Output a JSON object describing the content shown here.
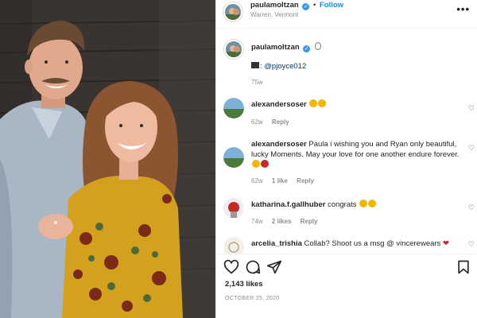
{
  "post": {
    "username": "paulamoltzan",
    "location": "Warren, Vermont",
    "follow_label": "Follow",
    "separator": "•",
    "more_label": "•••"
  },
  "caption": {
    "username": "paulamoltzan",
    "text": ": @pjoyce012",
    "time": "75w"
  },
  "comments": [
    {
      "username": "alexandersoser",
      "text": "",
      "time": "62w",
      "likes": "",
      "reply": "Reply"
    },
    {
      "username": "alexandersoser",
      "text": "Paula i wishing you and Ryan only beautiful, lucky Moments. May your love for one another endure forever.",
      "time": "62w",
      "likes": "1 like",
      "reply": "Reply"
    },
    {
      "username": "katharina.f.gallhuber",
      "text": "congrats",
      "time": "74w",
      "likes": "2 likes",
      "reply": "Reply"
    },
    {
      "username": "arcelia_trishia",
      "text": "Collab? Shoot us a msg @ vincerewears",
      "time": "",
      "likes": "",
      "reply": ""
    }
  ],
  "stats": {
    "likes": "2,143 likes",
    "date": "OCTOBER 25, 2020"
  },
  "icons": {
    "verified": "verified-badge",
    "like": "heart-icon",
    "comment": "comment-bubble-icon",
    "share": "paper-plane-icon",
    "save": "bookmark-icon"
  },
  "colors": {
    "link": "#0095f6",
    "verified": "#3897f0",
    "muted": "#8e8e8e",
    "text": "#262626"
  }
}
